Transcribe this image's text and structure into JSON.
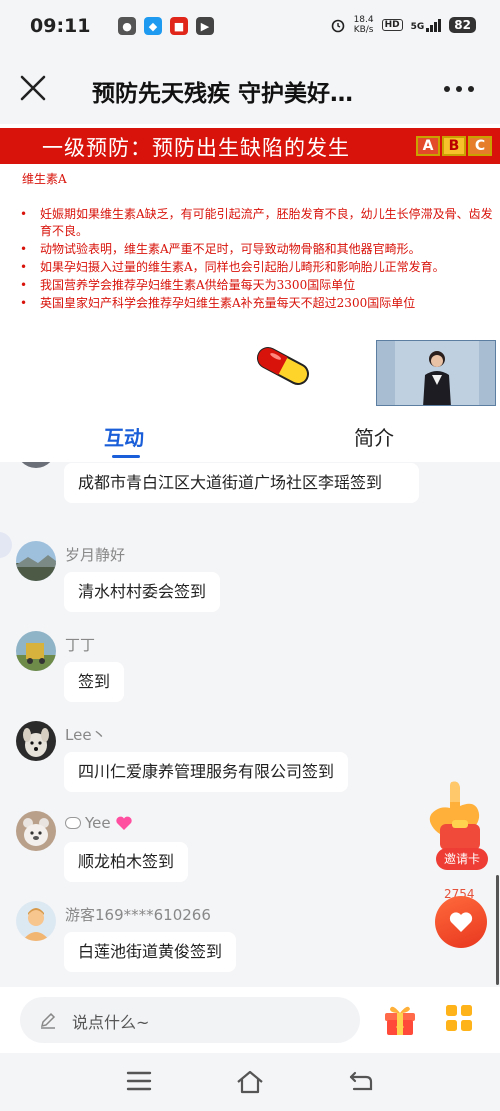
{
  "status_bar": {
    "time": "09:11",
    "net_speed_value": "18.4",
    "net_speed_unit": "KB/s",
    "hd_label": "HD",
    "signal_label": "5G",
    "battery": "82"
  },
  "header": {
    "title": "预防先天残疾 守护美好…"
  },
  "video": {
    "slide_title": "一级预防：预防出生缺陷的发生",
    "abc": [
      "A",
      "B",
      "C"
    ],
    "slide_subtitle": "维生素A",
    "bullets": [
      "妊娠期如果维生素A缺乏，有可能引起流产，胚胎发育不良，幼儿生长停滞及骨、齿发育不良。",
      "动物试验表明，维生素A严重不足时，可导致动物骨骼和其他器官畸形。",
      "如果孕妇摄入过量的维生素A，同样也会引起胎儿畸形和影响胎儿正常发育。",
      "我国营养学会推荐孕妇维生素A供给量每天为3300国际单位",
      "英国皇家妇产科学会推荐孕妇维生素A补充量每天不超过2300国际单位"
    ]
  },
  "tabs": {
    "interact": "互动",
    "intro": "简介"
  },
  "chat": {
    "messages": [
      {
        "user": "",
        "text": "成都市青白江区大道街道广场社区李瑶签到"
      },
      {
        "user": "岁月静好",
        "text": "清水村村委会签到"
      },
      {
        "user": "丁丁",
        "text": "签到"
      },
      {
        "user": "Lee丶",
        "text": "四川仁爱康养管理服务有限公司签到"
      },
      {
        "user": "Yee",
        "text": "顺龙柏木签到"
      },
      {
        "user": "游客169****610266",
        "text": "白莲池街道黄俊签到"
      }
    ]
  },
  "actions": {
    "invite_label": "邀请卡",
    "like_count": "2754"
  },
  "composer": {
    "placeholder": "说点什么~"
  },
  "colors": {
    "accent_blue": "#1a5fd9",
    "slide_red": "#d8130b",
    "like_red": "#e8371f"
  }
}
